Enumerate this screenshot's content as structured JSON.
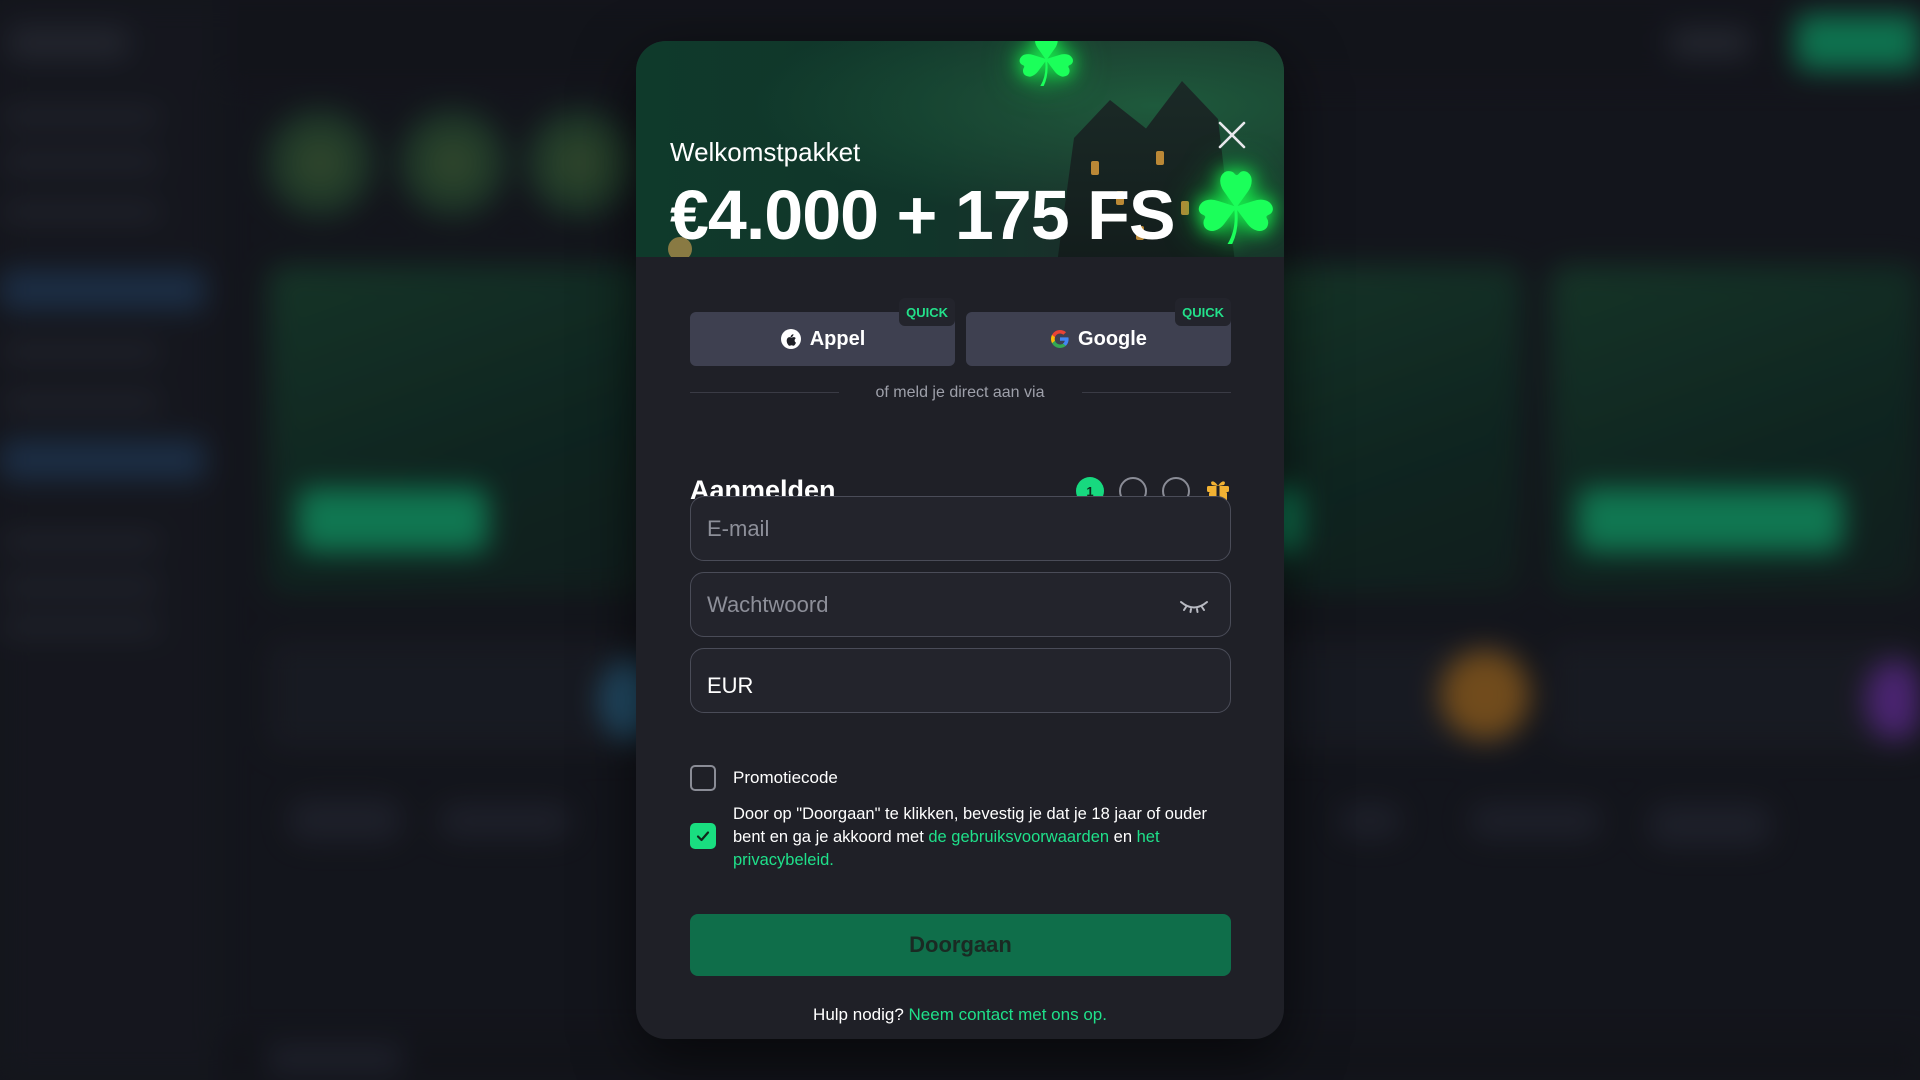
{
  "hero": {
    "subtitle": "Welkomstpakket",
    "title": "€4.000 + 175 FS"
  },
  "social": {
    "apple_label": "Appel",
    "google_label": "Google",
    "badge": "QUICK",
    "divider_text": "of meld je direct aan via"
  },
  "signup": {
    "heading": "Aanmelden",
    "steps": [
      "1",
      "",
      ""
    ],
    "current_step": 1,
    "email_placeholder": "E-mail",
    "password_placeholder": "Wachtwoord",
    "currency_value": "EUR",
    "promo_label": "Promotiecode",
    "promo_checked": false,
    "terms_checked": true,
    "terms_text_1": "Door op \"Doorgaan\" te klikken, bevestig je dat je 18 jaar of ouder bent en ga je akkoord met ",
    "terms_link_1": "de gebruiksvoorwaarden",
    "terms_text_2": " en ",
    "terms_link_2": "het privacybeleid.",
    "continue_label": "Doorgaan"
  },
  "help": {
    "text": "Hulp nodig? ",
    "link": "Neem contact met ons op."
  },
  "colors": {
    "accent": "#19de80",
    "modal_bg": "#1f2027",
    "continue_bg": "#0f6e4a",
    "social_bg": "#3e4050"
  },
  "icons": {
    "close": "close-icon",
    "apple": "apple-icon",
    "google": "google-icon",
    "eye": "eye-closed-icon",
    "gift": "gift-icon",
    "check": "check-icon"
  }
}
